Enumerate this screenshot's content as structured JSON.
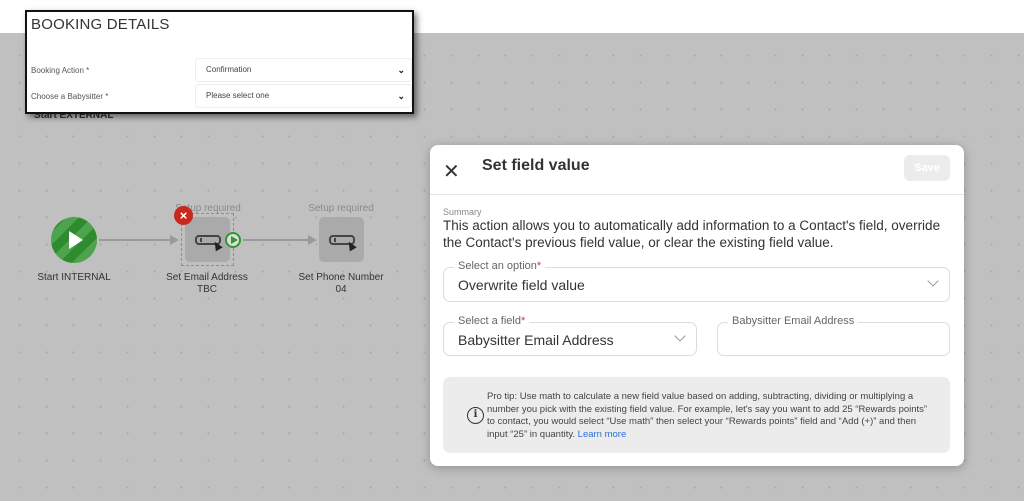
{
  "booking_details": {
    "title": "BOOKING DETAILS",
    "rows": [
      {
        "label": "Booking Action *",
        "value": "Confirmation"
      },
      {
        "label": "Choose a Babysitter *",
        "value": "Please select one"
      }
    ]
  },
  "canvas": {
    "start_external_label": "Start EXTERNAL",
    "nodes": [
      {
        "label_line1": "Start INTERNAL",
        "label_line2": ""
      },
      {
        "status": "Setup required",
        "label_line1": "Set Email Address",
        "label_line2": "TBC"
      },
      {
        "status": "Setup required",
        "label_line1": "Set Phone Number",
        "label_line2": "04"
      }
    ],
    "colors": {
      "start": "#2e8b2e",
      "selected_frame": "#3ac93a",
      "remove_badge": "#c8281e"
    }
  },
  "panel": {
    "title": "Set field value",
    "save_label": "Save",
    "summary_label": "Summary",
    "summary_text": "This action allows you to automatically add information to a Contact's field, override the Contact's previous field value, or clear the existing field value.",
    "option": {
      "legend": "Select an option",
      "required_mark": "*",
      "value": "Overwrite field value"
    },
    "field": {
      "legend": "Select a field",
      "required_mark": "*",
      "value": "Babysitter Email Address"
    },
    "value_input": {
      "legend": "Babysitter Email Address",
      "value": ""
    },
    "tip_text": "Pro tip: Use math to calculate a new field value based on adding, subtracting, dividing or multiplying a number you pick with the existing field value. For example, let's say you want to add 25 “Rewards points” to contact, you would select “Use math” then select your “Rewards points” field and “Add (+)” and then input “25” in quantity.",
    "tip_link": "Learn more",
    "colors": {
      "link": "#2f6fd6",
      "required": "#dd3333"
    }
  }
}
